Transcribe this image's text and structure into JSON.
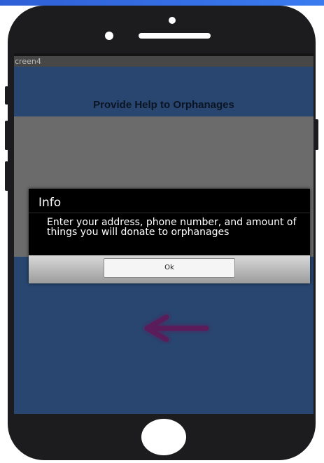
{
  "screen": {
    "window_title": "creen4",
    "heading": "Provide Help to Orphanages",
    "back_arrow_icon": "left-arrow-icon",
    "background_color": "#28466f",
    "arrow_color": "#5a1f5a"
  },
  "dialog": {
    "title": "Info",
    "message": "Enter your address, phone number, and amount of things you will donate to orphanages",
    "ok_label": "Ok"
  },
  "device": {
    "home_button_icon": "home-button-circle"
  }
}
